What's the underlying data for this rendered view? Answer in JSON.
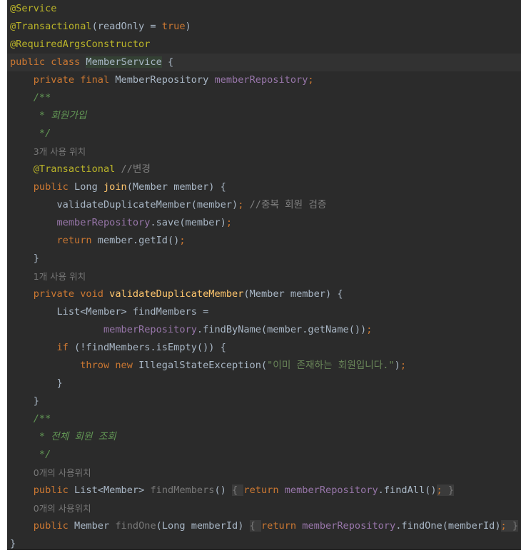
{
  "editor": {
    "lines": [
      {
        "indent": 0,
        "tokens": [
          [
            "ann",
            "@Service"
          ]
        ]
      },
      {
        "indent": 0,
        "tokens": [
          [
            "ann",
            "@Transactional"
          ],
          [
            "txt",
            "(readOnly = "
          ],
          [
            "kw",
            "true"
          ],
          [
            "txt",
            ")"
          ]
        ]
      },
      {
        "indent": 0,
        "tokens": [
          [
            "ann",
            "@RequiredArgsConstructor"
          ]
        ]
      },
      {
        "indent": 0,
        "current": true,
        "tokens": [
          [
            "kw",
            "public class "
          ],
          [
            "txt cls-hl",
            "MemberService"
          ],
          [
            "txt",
            " {"
          ]
        ]
      },
      {
        "indent": 1,
        "tokens": [
          [
            "kw",
            "private final "
          ],
          [
            "txt",
            "MemberRepository "
          ],
          [
            "fld",
            "memberRepository"
          ],
          [
            "kw",
            ";"
          ]
        ]
      },
      {
        "indent": 1,
        "tokens": [
          [
            "doc",
            "/**"
          ]
        ]
      },
      {
        "indent": 1,
        "tokens": [
          [
            "doc",
            " * 회원가입"
          ]
        ]
      },
      {
        "indent": 1,
        "tokens": [
          [
            "doc",
            " */"
          ]
        ]
      },
      {
        "indent": 1,
        "tokens": [
          [
            "hint",
            "3개 사용 위치"
          ]
        ]
      },
      {
        "indent": 1,
        "tokens": [
          [
            "ann",
            "@Transactional "
          ],
          [
            "cmt",
            "//변경"
          ]
        ]
      },
      {
        "indent": 1,
        "tokens": [
          [
            "kw",
            "public "
          ],
          [
            "txt",
            "Long "
          ],
          [
            "fn",
            "join"
          ],
          [
            "txt",
            "(Member member) {"
          ]
        ]
      },
      {
        "indent": 2,
        "tokens": [
          [
            "txt",
            "validateDuplicateMember(member)"
          ],
          [
            "kw",
            "; "
          ],
          [
            "cmt",
            "//중복 회원 검증"
          ]
        ]
      },
      {
        "indent": 2,
        "tokens": [
          [
            "fld",
            "memberRepository"
          ],
          [
            "txt",
            ".save(member)"
          ],
          [
            "kw",
            ";"
          ]
        ]
      },
      {
        "indent": 2,
        "tokens": [
          [
            "kw",
            "return "
          ],
          [
            "txt",
            "member.getId()"
          ],
          [
            "kw",
            ";"
          ]
        ]
      },
      {
        "indent": 1,
        "tokens": [
          [
            "txt",
            "}"
          ]
        ]
      },
      {
        "indent": 1,
        "tokens": [
          [
            "hint",
            "1개 사용 위치"
          ]
        ]
      },
      {
        "indent": 1,
        "tokens": [
          [
            "kw",
            "private void "
          ],
          [
            "fn",
            "validateDuplicateMember"
          ],
          [
            "txt",
            "(Member member) {"
          ]
        ]
      },
      {
        "indent": 2,
        "tokens": [
          [
            "txt",
            "List<Member> findMembers ="
          ]
        ]
      },
      {
        "indent": 4,
        "tokens": [
          [
            "fld",
            "memberRepository"
          ],
          [
            "txt",
            ".findByName(member.getName())"
          ],
          [
            "kw",
            ";"
          ]
        ]
      },
      {
        "indent": 2,
        "tokens": [
          [
            "kw",
            "if "
          ],
          [
            "txt",
            "(!findMembers.isEmpty()) {"
          ]
        ]
      },
      {
        "indent": 3,
        "tokens": [
          [
            "kw",
            "throw new "
          ],
          [
            "txt",
            "IllegalStateException("
          ],
          [
            "str",
            "\"이미 존재하는 회원입니다.\""
          ],
          [
            "txt",
            ")"
          ],
          [
            "kw",
            ";"
          ]
        ]
      },
      {
        "indent": 2,
        "tokens": [
          [
            "txt",
            "}"
          ]
        ]
      },
      {
        "indent": 1,
        "tokens": [
          [
            "txt",
            "}"
          ]
        ]
      },
      {
        "indent": 1,
        "tokens": [
          [
            "doc",
            "/**"
          ]
        ]
      },
      {
        "indent": 1,
        "tokens": [
          [
            "doc",
            " * 전체 회원 조회"
          ]
        ]
      },
      {
        "indent": 1,
        "tokens": [
          [
            "doc",
            " */"
          ]
        ]
      },
      {
        "indent": 1,
        "tokens": [
          [
            "hint",
            "0개의 사용위치"
          ]
        ]
      },
      {
        "indent": 1,
        "tokens": [
          [
            "kw",
            "public "
          ],
          [
            "txt",
            "List<Member> "
          ],
          [
            "unused",
            "findMembers"
          ],
          [
            "txt",
            "() "
          ],
          [
            "unused fold",
            "{ "
          ],
          [
            "kw",
            "return "
          ],
          [
            "fld",
            "memberRepository"
          ],
          [
            "txt",
            ".findAll()"
          ],
          [
            "kw fold",
            "; "
          ],
          [
            "unused fold",
            "}"
          ]
        ]
      },
      {
        "indent": 1,
        "tokens": [
          [
            "hint",
            "0개의 사용위치"
          ]
        ]
      },
      {
        "indent": 1,
        "tokens": [
          [
            "kw",
            "public "
          ],
          [
            "txt",
            "Member "
          ],
          [
            "unused",
            "findOne"
          ],
          [
            "txt",
            "(Long memberId) "
          ],
          [
            "unused fold",
            "{ "
          ],
          [
            "kw",
            "return "
          ],
          [
            "fld",
            "memberRepository"
          ],
          [
            "txt",
            ".findOne(memberId)"
          ],
          [
            "kw fold",
            "; "
          ],
          [
            "unused fold",
            "}"
          ]
        ]
      },
      {
        "indent": 0,
        "tokens": [
          [
            "txt",
            "}"
          ]
        ]
      }
    ]
  }
}
